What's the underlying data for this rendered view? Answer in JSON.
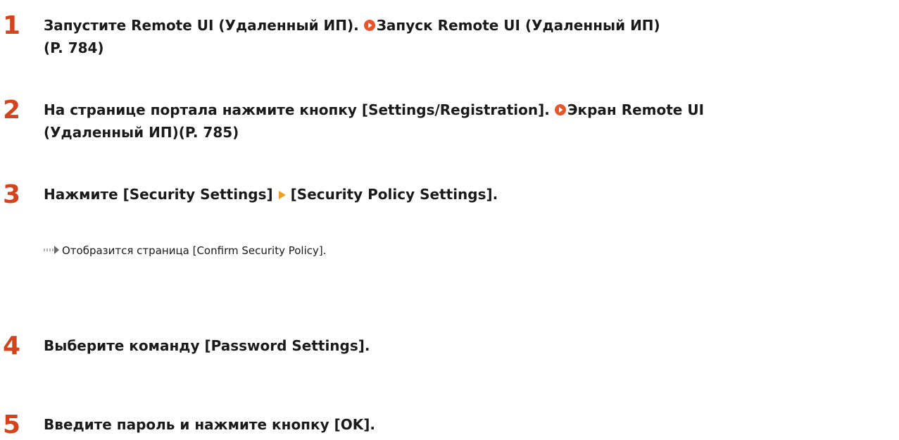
{
  "colors": {
    "step_number": "#d4441c",
    "link_icon": "#e8552a",
    "nav_arrow": "#f0a020",
    "result_arrow": "#b0b0b0"
  },
  "steps": [
    {
      "number": "1",
      "text": "Запустите Remote UI (Удаленный ИП). ",
      "link": "Запуск Remote UI (Удаленный ИП)",
      "link_page": "(P. 784)"
    },
    {
      "number": "2",
      "text": "На странице портала нажмите кнопку [Settings/Registration]. ",
      "link": "Экран Remote UI",
      "link_page": "(Удаленный ИП)(P. 785)"
    },
    {
      "number": "3",
      "text_before": "Нажмите [Security Settings]",
      "text_after": "[Security Policy Settings].",
      "result": "Отобразится страница [Confirm Security Policy]."
    },
    {
      "number": "4",
      "text": "Выберите команду [Password Settings]."
    },
    {
      "number": "5",
      "text": "Введите пароль и нажмите кнопку [OK]."
    }
  ]
}
